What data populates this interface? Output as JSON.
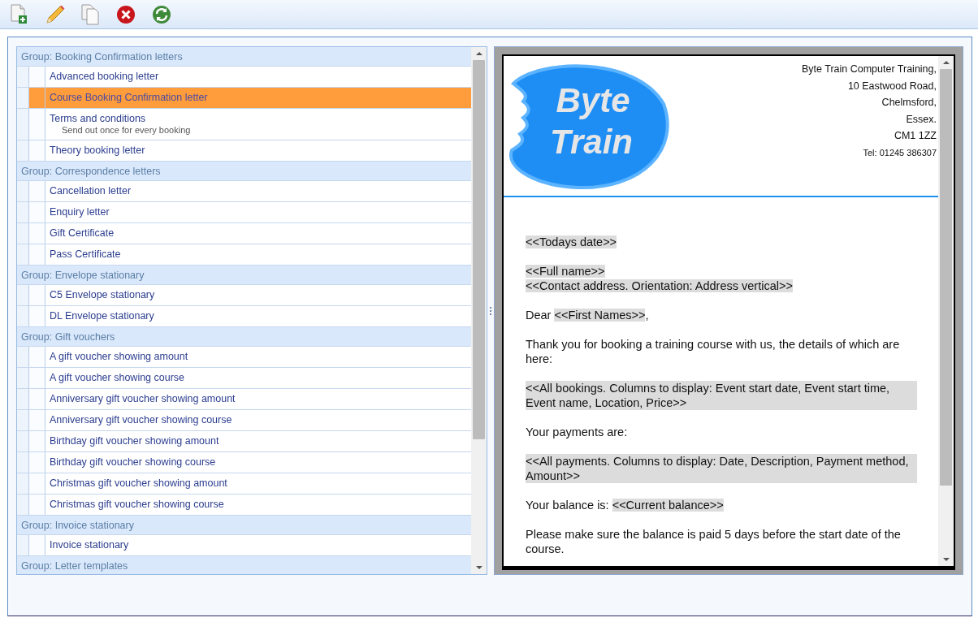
{
  "toolbar": {
    "buttons": [
      {
        "kind": "new"
      },
      {
        "kind": "edit"
      },
      {
        "kind": "copy"
      },
      {
        "kind": "delete"
      },
      {
        "kind": "refresh"
      }
    ]
  },
  "template_list": {
    "groups": [
      {
        "label": "Group: Booking Confirmation letters",
        "items": [
          {
            "label": "Advanced booking letter",
            "selected": false
          },
          {
            "label": "Course Booking Confirmation letter",
            "selected": true
          },
          {
            "label": "Terms and conditions",
            "note": "Send out once for every booking",
            "selected": false
          },
          {
            "label": "Theory booking letter",
            "selected": false
          }
        ]
      },
      {
        "label": "Group: Correspondence letters",
        "items": [
          {
            "label": "Cancellation letter",
            "selected": false
          },
          {
            "label": "Enquiry letter",
            "selected": false
          },
          {
            "label": "Gift Certificate",
            "selected": false
          },
          {
            "label": "Pass Certificate",
            "selected": false
          }
        ]
      },
      {
        "label": "Group: Envelope stationary",
        "items": [
          {
            "label": "C5 Envelope stationary",
            "selected": false
          },
          {
            "label": "DL Envelope stationary",
            "selected": false
          }
        ]
      },
      {
        "label": "Group: Gift vouchers",
        "items": [
          {
            "label": "A gift voucher showing amount",
            "selected": false
          },
          {
            "label": "A gift voucher showing course",
            "selected": false
          },
          {
            "label": "Anniversary gift voucher showing amount",
            "selected": false
          },
          {
            "label": "Anniversary gift voucher showing course",
            "selected": false
          },
          {
            "label": "Birthday gift voucher showing amount",
            "selected": false
          },
          {
            "label": "Birthday gift voucher showing course",
            "selected": false
          },
          {
            "label": "Christmas gift voucher showing amount",
            "selected": false
          },
          {
            "label": "Christmas gift voucher showing course",
            "selected": false
          }
        ]
      },
      {
        "label": "Group: Invoice stationary",
        "items": [
          {
            "label": "Invoice stationary",
            "selected": false
          }
        ]
      },
      {
        "label": "Group: Letter templates"
      }
    ]
  },
  "letter": {
    "logo": {
      "line_1": "Byte",
      "line_2": "Train"
    },
    "address": [
      "Byte Train Computer Training,",
      "10 Eastwood Road,",
      "Chelmsford,",
      "Essex.",
      "CM1 1ZZ"
    ],
    "telephone": "Tel: 01245  386307",
    "blocks": [
      [
        {
          "kind": "field",
          "text": "<<Todays date>>"
        }
      ],
      [
        {
          "kind": "field",
          "text": "<<Full name>>"
        },
        {
          "kind": "break"
        },
        {
          "kind": "field",
          "text": "<<Contact address. Orientation: Address vertical>>"
        }
      ],
      [
        {
          "kind": "text",
          "text": "Dear "
        },
        {
          "kind": "field",
          "text": "<<First Names>>"
        },
        {
          "kind": "text",
          "text": ","
        }
      ],
      [
        {
          "kind": "text",
          "text": "Thank you for booking a training course with us, the details of which are here:"
        }
      ],
      [
        {
          "kind": "wide_field",
          "text": "<<All bookings. Columns to display: Event start date, Event start time, Event name, Location, Price>>"
        }
      ],
      [
        {
          "kind": "text",
          "text": "Your payments are:"
        }
      ],
      [
        {
          "kind": "wide_field",
          "text": "<<All payments. Columns to display: Date, Description, Payment method, Amount>>"
        }
      ],
      [
        {
          "kind": "text",
          "text": "Your balance is:  "
        },
        {
          "kind": "field",
          "text": "<<Current balance>>"
        }
      ],
      [
        {
          "kind": "text",
          "text": "Please make sure the balance is paid 5 days before the start date of the course."
        }
      ]
    ]
  }
}
